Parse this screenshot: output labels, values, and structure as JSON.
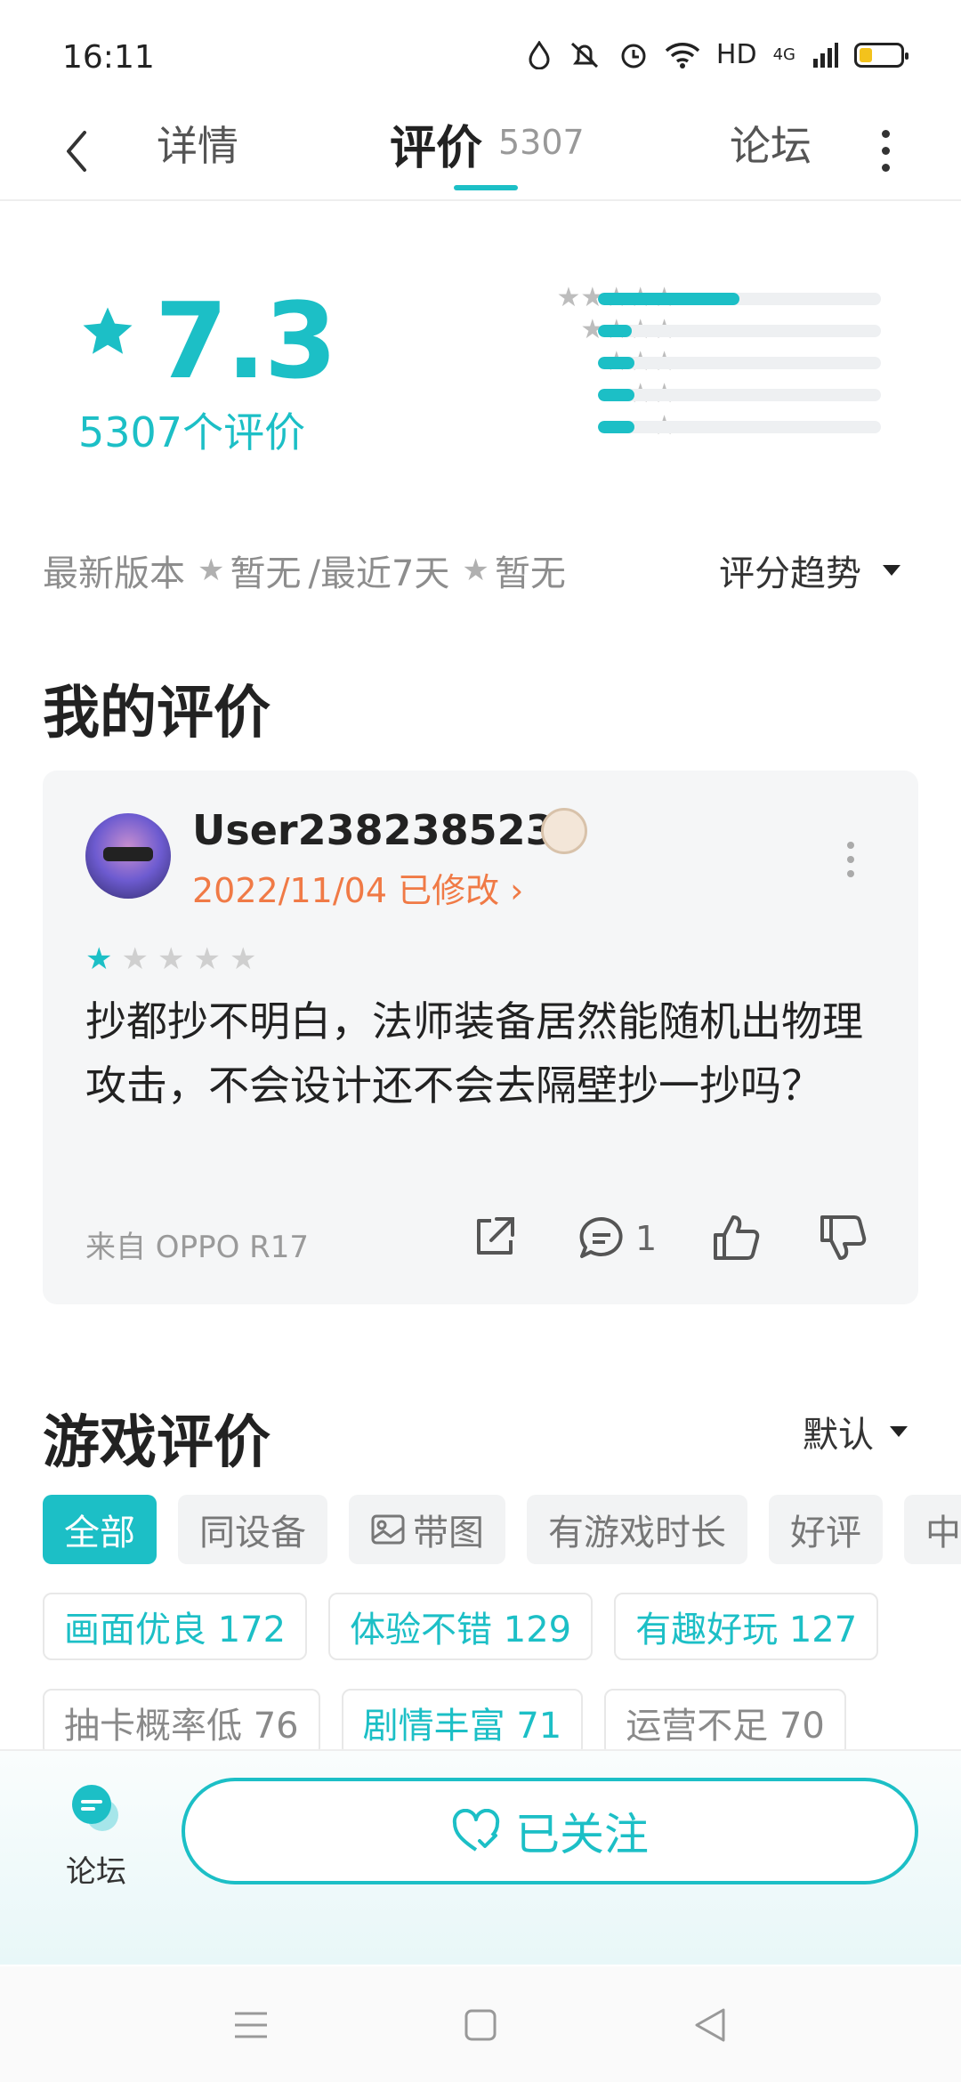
{
  "status_bar": {
    "time": "16:11",
    "network": "HD",
    "signal_label": "4G"
  },
  "nav": {
    "detail_tab": "详情",
    "review_tab": "评价",
    "review_count": "5307",
    "forum_tab": "论坛"
  },
  "score": {
    "value": "7.3",
    "count_label": "5307个评价",
    "distribution": [
      {
        "stars": 5,
        "fraction": 0.5
      },
      {
        "stars": 4,
        "fraction": 0.12
      },
      {
        "stars": 3,
        "fraction": 0.13
      },
      {
        "stars": 2,
        "fraction": 0.13
      },
      {
        "stars": 1,
        "fraction": 0.13
      }
    ]
  },
  "version_row": {
    "latest_label": "最新版本",
    "latest_value": "暂无",
    "sep": "/最近7天",
    "recent_value": "暂无",
    "trend_label": "评分趋势"
  },
  "my_review": {
    "title": "我的评价",
    "username": "User2382385238",
    "date": "2022/11/04 已修改 ›",
    "rating": 1,
    "text": "抄都抄不明白，法师装备居然能随机出物理攻击，不会设计还不会去隔壁抄一抄吗？",
    "device": "来自 OPPO R17",
    "comment_count": "1"
  },
  "game_reviews": {
    "title": "游戏评价",
    "sort_label": "默认",
    "filter_tabs": [
      "全部",
      "同设备",
      "带图",
      "有游戏时长",
      "好评",
      "中"
    ],
    "tags_row1": [
      "画面优良 172",
      "体验不错 129",
      "有趣好玩 127"
    ],
    "tags_row2": [
      "抽卡概率低 76",
      "剧情丰富 71",
      "运营不足 70"
    ]
  },
  "bottom_bar": {
    "forum_label": "论坛",
    "follow_label": "已关注"
  },
  "colors": {
    "accent": "#1cbfc6",
    "date": "#f07a46"
  }
}
